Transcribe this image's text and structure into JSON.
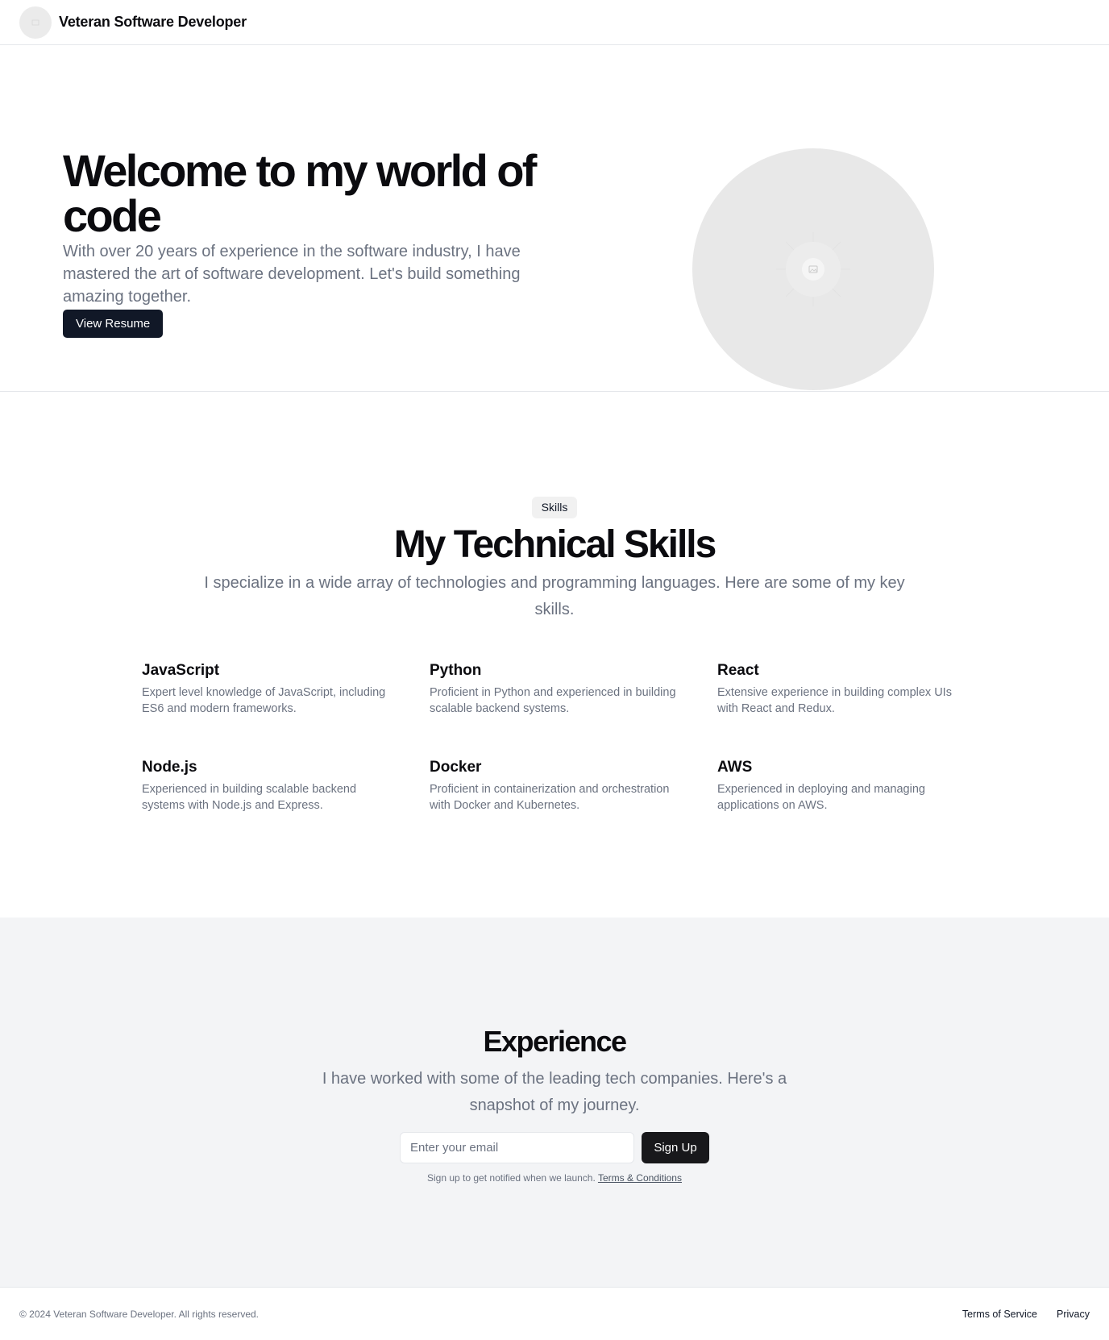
{
  "header": {
    "brand": "Veteran Software Developer",
    "logo_icon": "placeholder-image-icon"
  },
  "hero": {
    "title": "Welcome to my world of code",
    "subtitle": "With over 20 years of experience in the software industry, I have mastered the art of software development. Let's build something amazing together.",
    "resume_button": "View Resume",
    "image_icon": "placeholder-image-icon"
  },
  "skills": {
    "badge": "Skills",
    "title": "My Technical Skills",
    "subtitle": "I specialize in a wide array of technologies and programming languages. Here are some of my key skills.",
    "items": [
      {
        "name": "JavaScript",
        "description": "Expert level knowledge of JavaScript, including ES6 and modern frameworks."
      },
      {
        "name": "Python",
        "description": "Proficient in Python and experienced in building scalable backend systems."
      },
      {
        "name": "React",
        "description": "Extensive experience in building complex UIs with React and Redux."
      },
      {
        "name": "Node.js",
        "description": "Experienced in building scalable backend systems with Node.js and Express."
      },
      {
        "name": "Docker",
        "description": "Proficient in containerization and orchestration with Docker and Kubernetes."
      },
      {
        "name": "AWS",
        "description": "Experienced in deploying and managing applications on AWS."
      }
    ]
  },
  "experience": {
    "title": "Experience",
    "subtitle": "I have worked with some of the leading tech companies. Here's a snapshot of my journey.",
    "email_placeholder": "Enter your email",
    "signup_button": "Sign Up",
    "note": "Sign up to get notified when we launch.",
    "terms_link": "Terms & Conditions"
  },
  "footer": {
    "copyright": "© 2024 Veteran Software Developer. All rights reserved.",
    "links": [
      "Terms of Service",
      "Privacy"
    ]
  },
  "colors": {
    "button_dark": "#111827",
    "muted_text": "#6b7280",
    "section_bg": "#f3f4f6",
    "placeholder_bg": "#e8e8e8"
  }
}
